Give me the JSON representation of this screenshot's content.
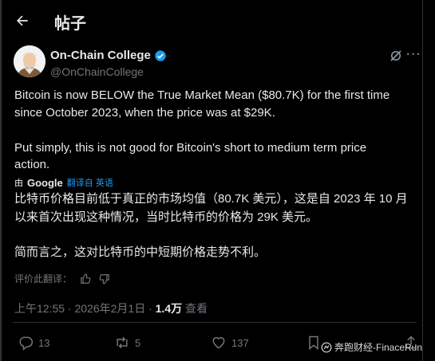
{
  "header": {
    "title": "帖子"
  },
  "author": {
    "name": "On-Chain College",
    "handle": "@OnChainCollege"
  },
  "post": {
    "en_lines": [
      "Bitcoin is now BELOW the True Market Mean ($80.7K) for the first time",
      "since October 2023, when the price was at $29K.",
      "Put simply, this is not good for Bitcoin's short to medium term price",
      "action."
    ],
    "translation": {
      "by": "由",
      "google": "Google",
      "link": "翻译自 英语"
    },
    "zh_lines": [
      "比特币价格目前低于真正的市场均值（80.7K 美元），这是自 2023 年 10 月",
      "以来首次出现这种情况，当时比特币的价格为 29K 美元。",
      "简而言之，这对比特币的中短期价格走势不利。"
    ],
    "rate_label": "评价此翻译：",
    "time": "上午12:55 · 2026年2月1日 · ",
    "views": "1.4万",
    "views_label": " 查看"
  },
  "actions": {
    "replies": "13",
    "reposts": "5",
    "likes": "137"
  },
  "watermark": "奔跑财经-FinaceRun",
  "colors": {
    "background": "#000000",
    "text": "#e7e9ea",
    "muted": "#71767b",
    "link": "#1d9bf0",
    "verified": "#1d9bf0"
  }
}
